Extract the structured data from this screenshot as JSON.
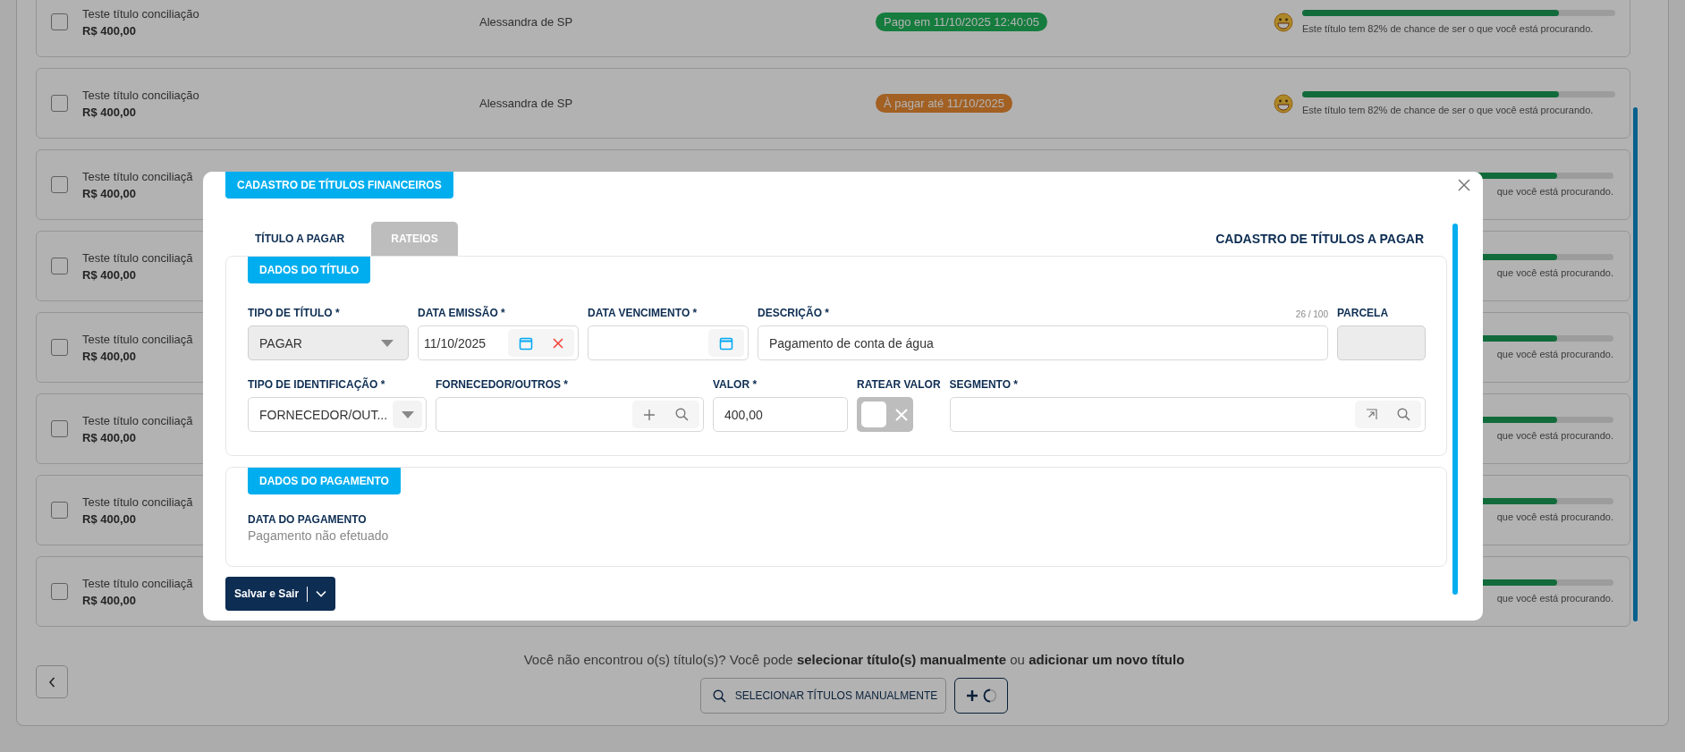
{
  "results": {
    "rows": [
      {
        "kind": "full",
        "checked": false,
        "title": "Teste título conciliação",
        "amount": "R$ 400,00",
        "name": "Alessandra de SP",
        "badge": {
          "kind": "paid",
          "text": "Pago em 11/10/2025 12:40:05"
        },
        "level": 0.82,
        "note": "Este título tem 82% de chance de ser o que você está procurando."
      },
      {
        "kind": "full",
        "checked": false,
        "title": "Teste título conciliação",
        "amount": "R$ 400,00",
        "name": "Alessandra de SP",
        "badge": {
          "kind": "due",
          "text": "À pagar até 11/10/2025"
        },
        "level": 0.82,
        "note": "Este título tem 82% de chance de ser o que você está procurando."
      },
      {
        "kind": "covered",
        "checked": false,
        "title": "Teste título conciliaçã",
        "amount": "R$ 400,00",
        "level": 0.82,
        "note": "que você está procurando."
      },
      {
        "kind": "covered",
        "checked": false,
        "title": "Teste título conciliaçã",
        "amount": "R$ 400,00",
        "level": 0.82,
        "note": "que você está procurando."
      },
      {
        "kind": "covered",
        "checked": false,
        "title": "Teste título conciliaçã",
        "amount": "R$ 400,00",
        "level": 0.82,
        "note": "que você está procurando."
      },
      {
        "kind": "covered",
        "checked": false,
        "title": "Teste título conciliaçã",
        "amount": "R$ 400,00",
        "level": 0.82,
        "note": "que você está procurando."
      },
      {
        "kind": "covered",
        "checked": false,
        "title": "Teste título conciliaçã",
        "amount": "R$ 400,00",
        "level": 0.82,
        "note": "que você está procurando."
      },
      {
        "kind": "covered",
        "checked": false,
        "title": "Teste título conciliaçã",
        "amount": "R$ 400,00",
        "level": 0.82,
        "note": "que você está procurando."
      }
    ]
  },
  "footer": {
    "message": "Você não encontrou o(s) título(s)? Você pode **selecionar título(s) manualmente** ou **adicionar um novo título**",
    "select_button": "SELECIONAR TÍTULOS MANUALMENTE"
  },
  "modal": {
    "badge": "CADASTRO DE TÍTULOS FINANCEIROS",
    "tabs": [
      {
        "label": "TÍTULO A PAGAR",
        "selected": true
      },
      {
        "label": "RATEIOS",
        "selected": false
      }
    ],
    "title": "CADASTRO DE TÍTULOS A PAGAR",
    "title_section": {
      "tag": "DADOS DO TÍTULO",
      "rows": [
        {
          "fields": [
            {
              "kind": "select",
              "label": "TIPO DE TÍTULO *",
              "value": "PAGAR",
              "disabled": true
            },
            {
              "kind": "date",
              "label": "DATA EMISSÃO *",
              "value": "11/10/2025"
            },
            {
              "kind": "date",
              "label": "DATA VENCIMENTO *"
            },
            {
              "kind": "text",
              "label": "DESCRIÇÃO *",
              "value": "Pagamento de conta de água",
              "counter": "26 / 100",
              "disabled": false
            },
            {
              "kind": "text",
              "label": "PARCELA",
              "disabled": true
            }
          ]
        },
        {
          "fields": [
            {
              "kind": "select",
              "label": "TIPO DE IDENTIFICAÇÃO *",
              "value": "FORNECEDOR/OUT...",
              "disabled": false
            },
            {
              "kind": "creatable",
              "label": "FORNECEDOR/OUTROS *"
            },
            {
              "kind": "text",
              "label": "VALOR *",
              "value": "400,00",
              "disabled": false
            },
            {
              "kind": "toggle",
              "label": "RATEAR VALOR",
              "on": false
            },
            {
              "kind": "lookup",
              "label": "SEGMENTO *"
            }
          ]
        }
      ]
    },
    "payment_section": {
      "tag": "DADOS DO PAGAMENTO",
      "label": "DATA DO PAGAMENTO",
      "value": "Pagamento não efetuado"
    },
    "save_button": "Salvar e Sair"
  }
}
